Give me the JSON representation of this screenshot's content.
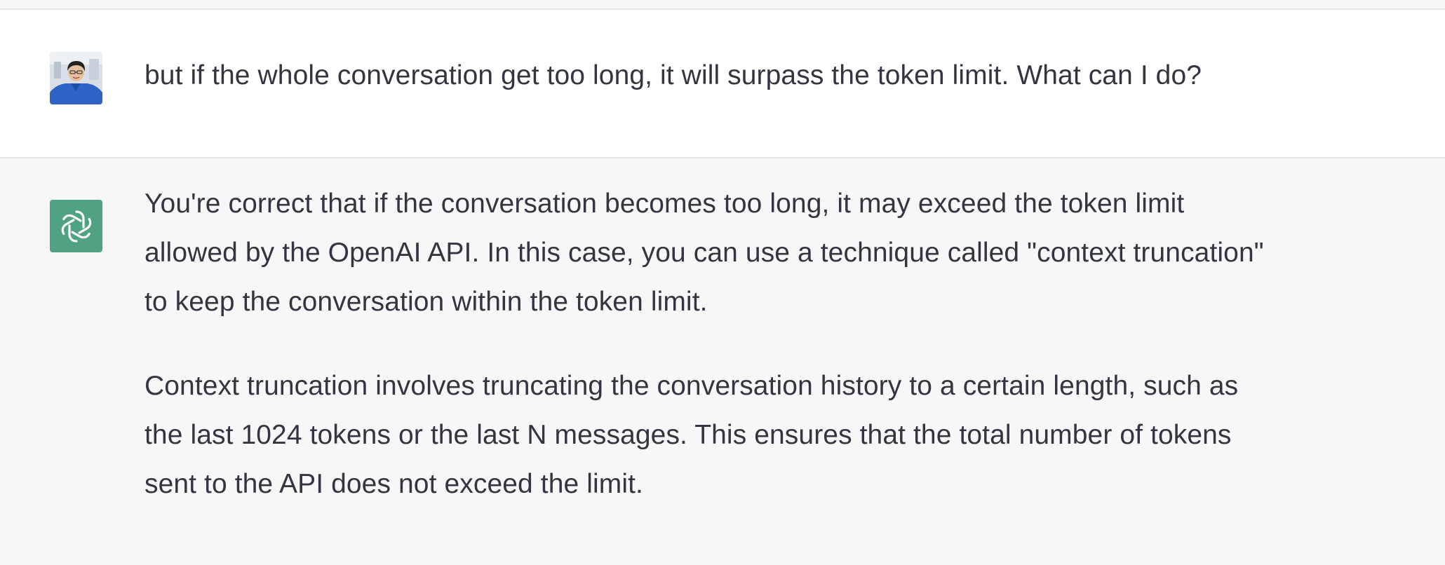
{
  "conversation": {
    "user_message": {
      "avatar_icon": "user-photo-avatar",
      "text": "but if the whole conversation get too long, it will surpass the token limit. What can I do?"
    },
    "assistant_message": {
      "avatar_icon": "openai-logo-icon",
      "avatar_color": "#4fa383",
      "paragraphs": [
        "You're correct that if the conversation becomes too long, it may exceed the token limit allowed by the OpenAI API. In this case, you can use a technique called \"context truncation\" to keep the conversation within the token limit.",
        "Context truncation involves truncating the conversation history to a certain length, such as the last 1024 tokens or the last N messages. This ensures that the total number of tokens sent to the API does not exceed the limit."
      ]
    }
  },
  "colors": {
    "background": "#f7f7f8",
    "user_row_background": "#ffffff",
    "text": "#343541"
  }
}
